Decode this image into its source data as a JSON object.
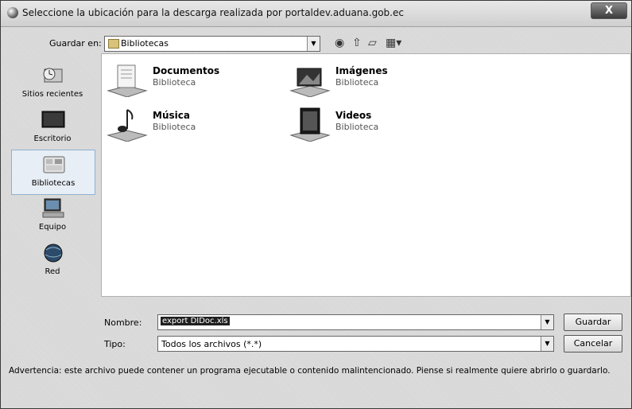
{
  "window": {
    "title": "Seleccione la ubicación para la descarga realizada por portaldev.aduana.gob.ec",
    "close_label": "X"
  },
  "toolbar": {
    "look_in_label": "Guardar en:",
    "look_in_value": "Bibliotecas",
    "icons": [
      "back-icon",
      "up-folder-icon",
      "new-folder-icon",
      "view-menu-icon"
    ]
  },
  "sidebar": {
    "items": [
      {
        "label": "Sitios recientes",
        "icon": "recent-places-icon"
      },
      {
        "label": "Escritorio",
        "icon": "desktop-icon"
      },
      {
        "label": "Bibliotecas",
        "icon": "libraries-icon",
        "selected": true
      },
      {
        "label": "Equipo",
        "icon": "computer-icon"
      },
      {
        "label": "Red",
        "icon": "network-icon"
      }
    ]
  },
  "libraries": [
    {
      "name": "Documentos",
      "type": "Biblioteca",
      "icon": "documents-library-icon"
    },
    {
      "name": "Imágenes",
      "type": "Biblioteca",
      "icon": "pictures-library-icon"
    },
    {
      "name": "Música",
      "type": "Biblioteca",
      "icon": "music-library-icon"
    },
    {
      "name": "Videos",
      "type": "Biblioteca",
      "icon": "videos-library-icon"
    }
  ],
  "form": {
    "name_label": "Nombre:",
    "name_value": "export DIDoc.xls",
    "type_label": "Tipo:",
    "type_value": "Todos los archivos (*.*)"
  },
  "buttons": {
    "save": "Guardar",
    "cancel": "Cancelar"
  },
  "warning": "Advertencia: este archivo puede contener un programa ejecutable o contenido malintencionado. Piense si realmente quiere abrirlo o guardarlo."
}
